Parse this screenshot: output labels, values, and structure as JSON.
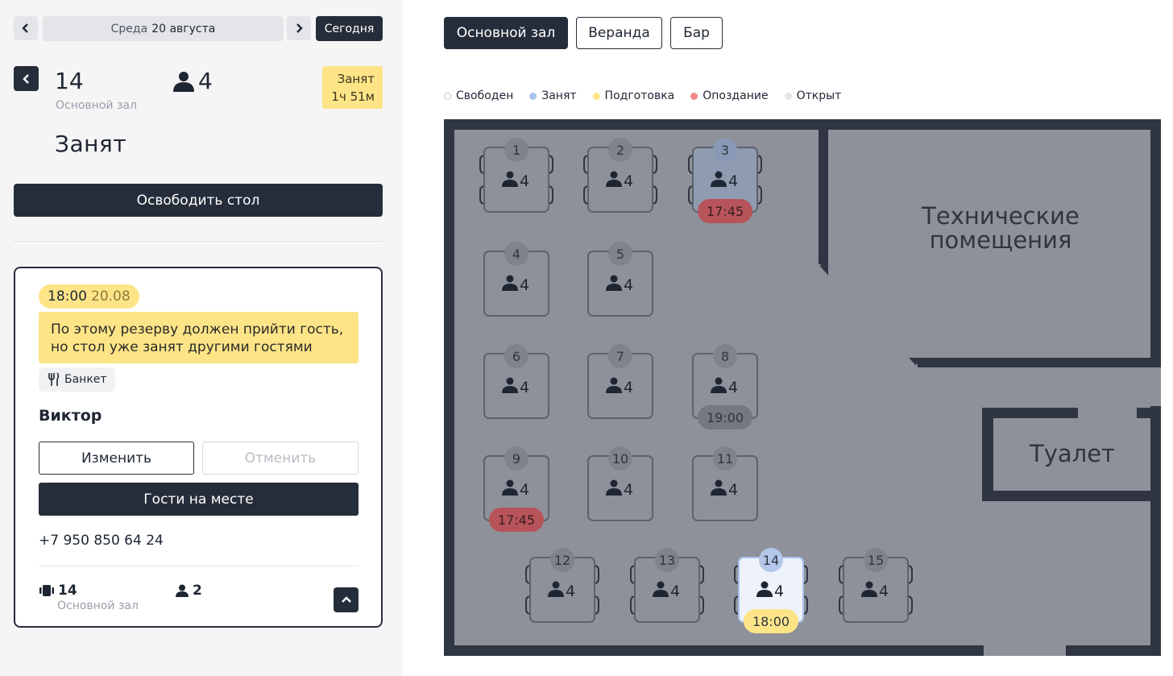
{
  "date_nav": {
    "weekday": "Среда",
    "date": "20 августа",
    "today_label": "Сегодня"
  },
  "table_info": {
    "number": "14",
    "zone": "Основной зал",
    "guests": "4",
    "badge_line1": "Занят",
    "badge_line2": "1ч 51м",
    "status": "Занят",
    "free_button": "Освободить стол"
  },
  "reservation": {
    "time": "18:00",
    "date": "20.08",
    "warning": "По этому резерву должен прийти гость, но стол уже занят другими гостями",
    "tag": "Банкет",
    "guest_name": "Виктор",
    "edit_label": "Изменить",
    "cancel_label": "Отменить",
    "arrived_label": "Гости на месте",
    "phone": "+7 950 850 64 24",
    "footer_table": "14",
    "footer_zone": "Основной зал",
    "footer_guests": "2"
  },
  "zones": [
    {
      "label": "Основной зал",
      "active": true
    },
    {
      "label": "Веранда",
      "active": false
    },
    {
      "label": "Бар",
      "active": false
    }
  ],
  "legend": [
    {
      "label": "Свободен",
      "color": "#ffffff"
    },
    {
      "label": "Занят",
      "color": "#a9c4ea"
    },
    {
      "label": "Подготовка",
      "color": "#fde587"
    },
    {
      "label": "Опоздание",
      "color": "#ef8a87"
    },
    {
      "label": "Открыт",
      "color": "#e3e5e8"
    }
  ],
  "rooms": {
    "tech": [
      "Технические",
      "помещения"
    ],
    "toilet": "Туалет"
  },
  "tables": [
    {
      "num": "1",
      "guests": "4",
      "state": "free"
    },
    {
      "num": "2",
      "guests": "4",
      "state": "free"
    },
    {
      "num": "3",
      "guests": "4",
      "state": "occupied",
      "time": "17:45",
      "time_state": "late"
    },
    {
      "num": "4",
      "guests": "4",
      "state": "free"
    },
    {
      "num": "5",
      "guests": "4",
      "state": "free"
    },
    {
      "num": "6",
      "guests": "4",
      "state": "free"
    },
    {
      "num": "7",
      "guests": "4",
      "state": "free"
    },
    {
      "num": "8",
      "guests": "4",
      "state": "free",
      "time": "19:00",
      "time_state": "open"
    },
    {
      "num": "9",
      "guests": "4",
      "state": "free",
      "time": "17:45",
      "time_state": "late"
    },
    {
      "num": "10",
      "guests": "4",
      "state": "free"
    },
    {
      "num": "11",
      "guests": "4",
      "state": "free"
    },
    {
      "num": "12",
      "guests": "4",
      "state": "free"
    },
    {
      "num": "13",
      "guests": "4",
      "state": "free"
    },
    {
      "num": "14",
      "guests": "4",
      "state": "selected",
      "time": "18:00",
      "time_state": "prep"
    },
    {
      "num": "15",
      "guests": "4",
      "state": "free"
    }
  ]
}
